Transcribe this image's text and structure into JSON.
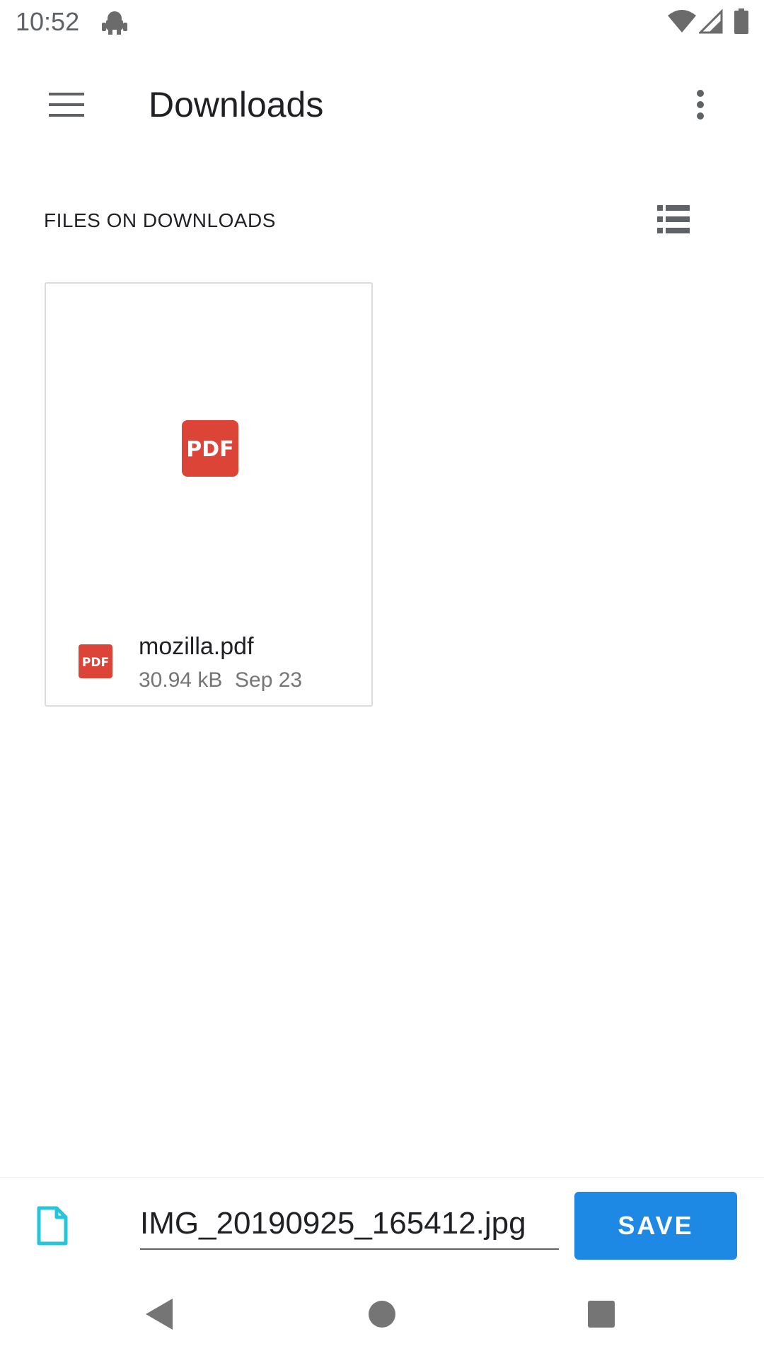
{
  "status_bar": {
    "time": "10:52",
    "icons": [
      "robot-icon",
      "wifi-icon",
      "signal-icon",
      "battery-icon"
    ]
  },
  "toolbar": {
    "title": "Downloads",
    "menu_icon": "hamburger-menu-icon",
    "overflow_icon": "more-vert-icon"
  },
  "section": {
    "header": "FILES ON DOWNLOADS",
    "view_toggle_icon": "list-view-icon"
  },
  "files": [
    {
      "name": "mozilla.pdf",
      "size": "30.94 kB",
      "date": "Sep 23",
      "type_badge": "PDF"
    }
  ],
  "save_bar": {
    "filename": "IMG_20190925_165412.jpg",
    "save_label": "SAVE",
    "file_icon": "document-icon"
  },
  "colors": {
    "accent": "#1e88e5",
    "pdf_red": "#db4437",
    "doc_icon": "#26c6da"
  },
  "nav": {
    "icons": [
      "back-icon",
      "home-icon",
      "recents-icon"
    ]
  }
}
